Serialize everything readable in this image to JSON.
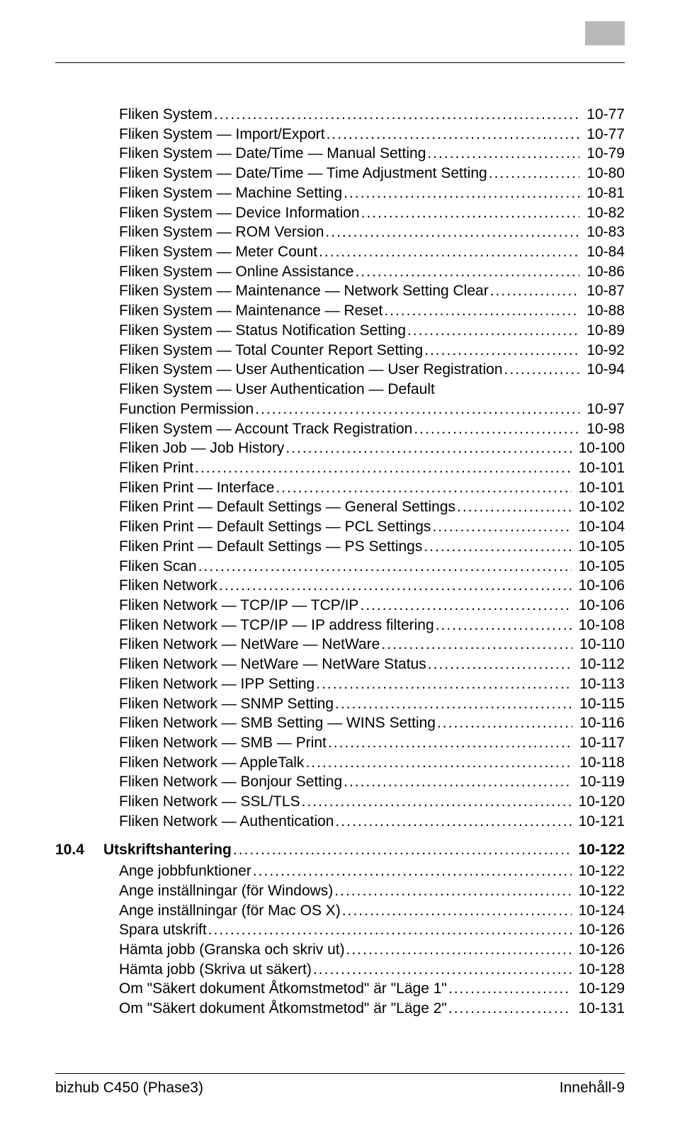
{
  "toc": [
    {
      "label": "Fliken System",
      "page": "10-77",
      "level": 1
    },
    {
      "label": "Fliken System — Import/Export",
      "page": "10-77",
      "level": 1
    },
    {
      "label": "Fliken System — Date/Time — Manual Setting",
      "page": "10-79",
      "level": 1
    },
    {
      "label": "Fliken System — Date/Time — Time Adjustment Setting",
      "page": "10-80",
      "level": 1
    },
    {
      "label": "Fliken System — Machine Setting",
      "page": "10-81",
      "level": 1
    },
    {
      "label": "Fliken System — Device Information",
      "page": "10-82",
      "level": 1
    },
    {
      "label": "Fliken System — ROM Version",
      "page": "10-83",
      "level": 1
    },
    {
      "label": "Fliken System — Meter Count",
      "page": "10-84",
      "level": 1
    },
    {
      "label": "Fliken System — Online Assistance",
      "page": "10-86",
      "level": 1
    },
    {
      "label": "Fliken System — Maintenance — Network Setting Clear",
      "page": "10-87",
      "level": 1
    },
    {
      "label": "Fliken System — Maintenance — Reset",
      "page": "10-88",
      "level": 1
    },
    {
      "label": "Fliken System — Status Notification Setting",
      "page": "10-89",
      "level": 1
    },
    {
      "label": "Fliken System — Total Counter Report Setting",
      "page": "10-92",
      "level": 1
    },
    {
      "label": "Fliken System — User Authentication — User Registration",
      "page": "10-94",
      "level": 1
    },
    {
      "type": "multi",
      "line1": "Fliken System — User Authentication — Default",
      "line2": "Function Permission",
      "page": "10-97",
      "level": 1
    },
    {
      "label": "Fliken System — Account Track Registration",
      "page": "10-98",
      "level": 1
    },
    {
      "label": "Fliken Job — Job History",
      "page": "10-100",
      "level": 1
    },
    {
      "label": "Fliken Print",
      "page": "10-101",
      "level": 1
    },
    {
      "label": "Fliken Print — Interface",
      "page": "10-101",
      "level": 1
    },
    {
      "label": "Fliken Print — Default Settings — General Settings",
      "page": "10-102",
      "level": 1
    },
    {
      "label": "Fliken Print — Default Settings — PCL Settings",
      "page": "10-104",
      "level": 1
    },
    {
      "label": "Fliken Print — Default Settings — PS Settings",
      "page": "10-105",
      "level": 1
    },
    {
      "label": "Fliken Scan",
      "page": "10-105",
      "level": 1
    },
    {
      "label": "Fliken Network",
      "page": "10-106",
      "level": 1
    },
    {
      "label": "Fliken Network — TCP/IP — TCP/IP",
      "page": "10-106",
      "level": 1
    },
    {
      "label": "Fliken Network — TCP/IP — IP address filtering",
      "page": "10-108",
      "level": 1
    },
    {
      "label": "Fliken Network — NetWare — NetWare",
      "page": "10-110",
      "level": 1
    },
    {
      "label": "Fliken Network — NetWare — NetWare Status",
      "page": "10-112",
      "level": 1
    },
    {
      "label": "Fliken Network — IPP Setting",
      "page": "10-113",
      "level": 1
    },
    {
      "label": "Fliken Network — SNMP Setting",
      "page": "10-115",
      "level": 1
    },
    {
      "label": "Fliken Network — SMB Setting — WINS Setting",
      "page": "10-116",
      "level": 1
    },
    {
      "label": "Fliken Network — SMB — Print",
      "page": "10-117",
      "level": 1
    },
    {
      "label": "Fliken Network — AppleTalk",
      "page": "10-118",
      "level": 1
    },
    {
      "label": "Fliken Network — Bonjour Setting",
      "page": "10-119",
      "level": 1
    },
    {
      "label": "Fliken Network — SSL/TLS",
      "page": "10-120",
      "level": 1
    },
    {
      "label": "Fliken Network — Authentication",
      "page": "10-121",
      "level": 1
    },
    {
      "type": "section",
      "num": "10.4",
      "label": "Utskriftshantering",
      "page": "10-122"
    },
    {
      "label": "Ange jobbfunktioner",
      "page": "10-122",
      "level": 2
    },
    {
      "label": "Ange inställningar (för Windows)",
      "page": "10-122",
      "level": 2
    },
    {
      "label": "Ange inställningar (för Mac OS X)",
      "page": "10-124",
      "level": 2
    },
    {
      "label": "Spara utskrift",
      "page": "10-126",
      "level": 2
    },
    {
      "label": "Hämta jobb (Granska och skriv ut)",
      "page": "10-126",
      "level": 2
    },
    {
      "label": "Hämta jobb (Skriva ut säkert)",
      "page": "10-128",
      "level": 2
    },
    {
      "label": "Om \"Säkert dokument Åtkomstmetod\" är \"Läge 1\"",
      "page": "10-129",
      "level": 2
    },
    {
      "label": "Om \"Säkert dokument Åtkomstmetod\" är \"Läge 2\"",
      "page": "10-131",
      "level": 2
    }
  ],
  "footer": {
    "left": "bizhub C450 (Phase3)",
    "right": "Innehåll-9"
  }
}
